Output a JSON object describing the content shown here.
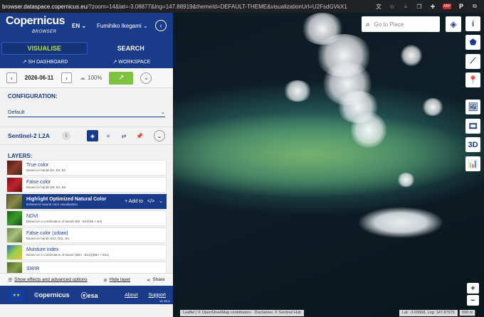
{
  "browser": {
    "url_domain": "browser.dataspace.copernicus.eu",
    "url_rest": "/?zoom=14&lat=-3.08877&lng=147.88919&themeId=DEFAULT-THEME&visualizationUrl=U2FsdGVkX1"
  },
  "header": {
    "logo": "Copernicus",
    "logo_sub": "BROWSER",
    "language": "EN",
    "user": "Fumihiko Ikegami"
  },
  "tabs": {
    "visualise": "VISUALISE",
    "search": "SEARCH"
  },
  "links": {
    "sh_dashboard": "SH DASHBOARD",
    "workspace": "WORKSPACE"
  },
  "datebar": {
    "date": "2026-06-11",
    "cloud": "100%"
  },
  "config": {
    "title": "CONFIGURATION:",
    "selected": "Default"
  },
  "dataset": {
    "name": "Sentinel-2 L2A"
  },
  "layers": {
    "title": "LAYERS:",
    "items": [
      {
        "name": "True color",
        "desc": "Based on bands B4, B3, B2",
        "thumb": "#7a2b22"
      },
      {
        "name": "False color",
        "desc": "Based on bands B8, B4, B3",
        "thumb": "#b01e2a"
      },
      {
        "name": "Highlight Optimized Natural Color",
        "desc": "Enhanced natural color visualisation",
        "thumb": "#6f7a3a"
      },
      {
        "name": "NDVI",
        "desc": "Based on a combination of bands (B8 - B4)/(B8 + B4)",
        "thumb": "#2f7d28"
      },
      {
        "name": "False color (urban)",
        "desc": "Based on bands B12, B11, B4",
        "thumb": "#8aa160"
      },
      {
        "name": "Moisture index",
        "desc": "Based on a combination of bands (B8A - B11)/(B8A + B11)",
        "thumb": "#4aa0c8"
      },
      {
        "name": "SWIR",
        "desc": "",
        "thumb": "#6c8a3a"
      }
    ],
    "selected_actions": {
      "add": "Add to"
    }
  },
  "footer_actions": {
    "effects": "Show effects and advanced options",
    "hide": "Hide layer",
    "share": "Share"
  },
  "footer": {
    "cop": "opernicus",
    "esa": "esa",
    "about": "About",
    "support": "Support",
    "version": "v1.41.1"
  },
  "map": {
    "search_placeholder": "Go to Place",
    "attribution": "Leaflet | © OpenStreetMap contributors - Disclaimer, © Sentinel Hub",
    "coords": "Lat: -3.09908, Lng: 147.87975",
    "scale": "500 m",
    "tools": [
      "i",
      "⬟",
      "⟋",
      "📍",
      "🖼",
      "🎞",
      "3D",
      "📊"
    ],
    "zoom_in": "+",
    "zoom_out": "−"
  }
}
